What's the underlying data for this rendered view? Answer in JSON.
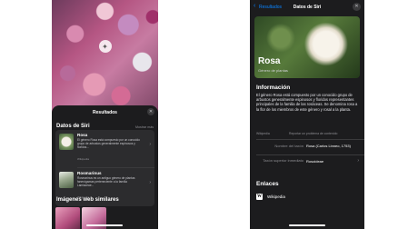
{
  "left_screen": {
    "sheet_title": "Resultados",
    "close_glyph": "✕",
    "siri_section": {
      "heading": "Datos de Siri",
      "show_more": "Mostrar más",
      "results": [
        {
          "name": "Rosa",
          "description": "El género Rosa está compuesto por un conocido grupo de arbustos generalmente espinosos y floridos...",
          "source": "Wikipedia",
          "thumb_icon": "rose-thumbnail"
        },
        {
          "name": "Rosmarinus",
          "description": "Rosmarinus es un antiguo género de plantas fanerógamas perteneciente a la familia Lamiaceae...",
          "source": "Wikipedia",
          "thumb_icon": "rosemary-thumbnail"
        }
      ]
    },
    "web_images_heading": "Imágenes web similares"
  },
  "right_screen": {
    "back_label": "Resultados",
    "nav_title": "Datos de Siri",
    "close_glyph": "✕",
    "hero": {
      "title": "Rosa",
      "subtitle": "Género de plantas"
    },
    "info": {
      "heading": "Información",
      "text": "El género Rosa está compuesto por un conocido grupo de arbustos generalmente espinosos y floridos representantes principales de la familia de las rosáceas. Se denomina rosa a la flor de los miembros de este género y rosal a la planta.",
      "source_left": "Wikipedia",
      "source_right": "Reportar un problema de contenido"
    },
    "fields": [
      {
        "label": "Nombre del taxón",
        "value": "Rosa (Carlos Linneo, 1753)"
      },
      {
        "label": "Taxón superior inmediato",
        "value": "Rosoideae"
      }
    ],
    "links": {
      "heading": "Enlaces",
      "items": [
        {
          "label": "Wikipedia",
          "icon_glyph": "W"
        }
      ]
    }
  }
}
